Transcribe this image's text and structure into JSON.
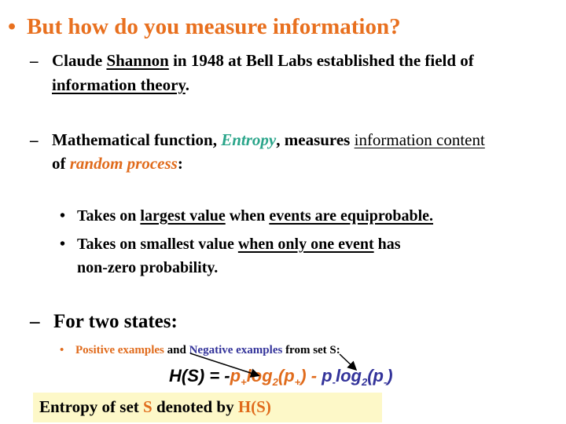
{
  "slide": {
    "title_bullet": "•",
    "title": "But how do you measure information?",
    "points": [
      {
        "dash": "–",
        "line1_a": "Claude ",
        "line1_u": "Shannon",
        "line1_b": " in 1948 at Bell Labs established the field of",
        "line2_u": "information theory",
        "line2_b": "."
      },
      {
        "dash": "–",
        "line1_a": "Mathematical function, ",
        "line1_em": "Entropy",
        "line1_b": ", measures ",
        "line1_u": "information content",
        "line2_a": "of ",
        "line2_em": "random process",
        "line2_b": ":"
      }
    ],
    "sub_points": [
      {
        "bullet": "•",
        "a": "Takes on ",
        "u1": "largest value",
        "b": " when ",
        "u2": "events are equiprobable."
      },
      {
        "bullet": "•",
        "a": "Takes on smallest value ",
        "u1": "when only one event",
        "b": " has",
        "line2": "non-zero probability."
      }
    ],
    "two_states": {
      "dash": "–",
      "heading": "For two states:",
      "bullet": "•",
      "positive": "Positive examples",
      "and": " and ",
      "negative": "Negative examples",
      "rest": " from set S:"
    },
    "formula": {
      "lhs": "H(S) = -",
      "p_plus": "p",
      "plus_sub": "+",
      "log_plus": "log",
      "two_sub_1": "2",
      "arg_plus_open": "(p",
      "arg_plus_sub": "+",
      "arg_plus_close": ")",
      "minus": " - ",
      "p_minus": "p",
      "minus_sub": "-",
      "log_minus": "log",
      "two_sub_2": "2",
      "arg_minus_open": "(p",
      "arg_minus_sub": "-",
      "arg_minus_close": ")"
    },
    "note_box": {
      "a": "Entropy of set ",
      "s": "S",
      "b": " denoted by ",
      "hs": "H(S)"
    }
  },
  "colors": {
    "title": "#e8701f",
    "accent_orange": "#e06b1c",
    "accent_teal": "#2aa58a",
    "accent_blue": "#33339a",
    "note_bg": "#fdf8c8"
  }
}
